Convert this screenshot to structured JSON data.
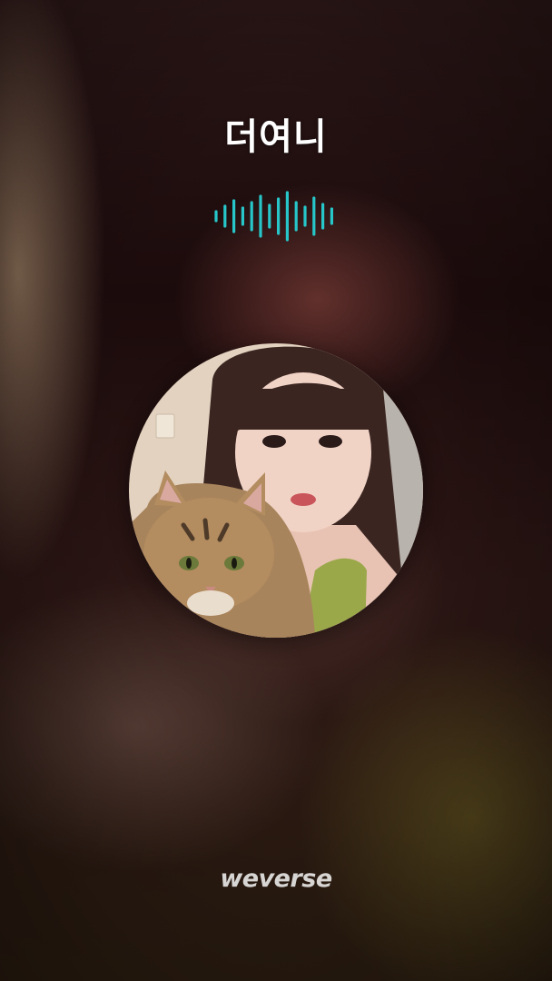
{
  "call": {
    "caller_name": "더여니",
    "status_icon": "audio-waveform-icon",
    "avatar_icon": "profile-photo"
  },
  "brand": {
    "logo_text": "weverse"
  },
  "colors": {
    "waveform": "#27c6c9",
    "text": "#ffffff"
  }
}
